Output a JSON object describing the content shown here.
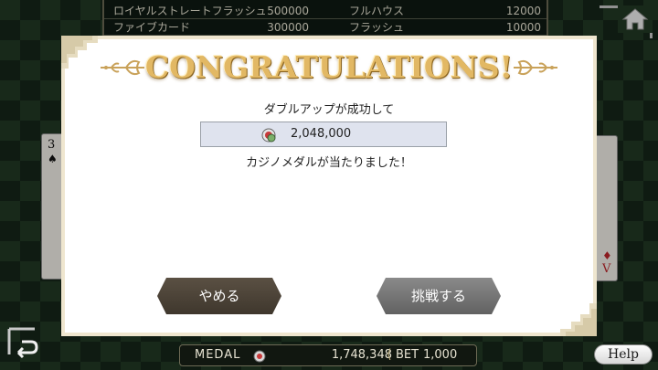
{
  "paytable": {
    "rows": [
      {
        "name1": "ロイヤルストレートフラッシュ",
        "val1": "500000",
        "name2": "フルハウス",
        "val2": "12000"
      },
      {
        "name1": "ファイブカード",
        "val1": "300000",
        "name2": "フラッシュ",
        "val2": "10000"
      }
    ]
  },
  "cards": {
    "left": {
      "rank": "3",
      "suit": "♠"
    },
    "right": {
      "rank": "V",
      "suit": "♦"
    }
  },
  "modal": {
    "title": "CONGRATULATIONS!",
    "success_message": "ダブルアップが成功して",
    "amount": "2,048,000",
    "won_message": "カジノメダルが当たりました！",
    "quit_label": "やめる",
    "retry_label": "挑戦する"
  },
  "status": {
    "medal_label": "MEDAL",
    "medal_value": "1,748,348",
    "bet_label": "BET",
    "bet_value": "1,000"
  },
  "help_label": "Help",
  "icons": {
    "home": "home-icon",
    "back": "back-arrow-icon",
    "chip": "casino-chip-icon",
    "flourish": "ornament-flourish-icon"
  },
  "colors": {
    "felt": "#223a24",
    "title_gold": "#e2b864",
    "quit_button": "#4d4438",
    "retry_button": "#767676"
  }
}
